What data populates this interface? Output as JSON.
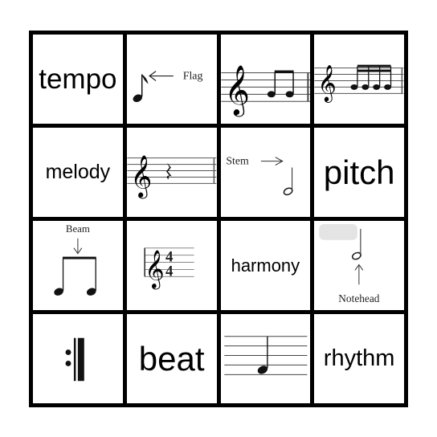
{
  "board": {
    "cells": [
      {
        "type": "text",
        "text": "tempo"
      },
      {
        "type": "image",
        "icon": "eighth-note-flag-icon",
        "label": "Flag"
      },
      {
        "type": "image",
        "icon": "treble-staff-two-eighth-notes-icon"
      },
      {
        "type": "image",
        "icon": "treble-staff-four-sixteenth-notes-icon"
      },
      {
        "type": "text",
        "text": "melody"
      },
      {
        "type": "image",
        "icon": "treble-staff-quarter-rest-icon"
      },
      {
        "type": "image",
        "icon": "half-note-stem-icon",
        "label": "Stem"
      },
      {
        "type": "text",
        "text": "pitch"
      },
      {
        "type": "image",
        "icon": "beamed-eighth-notes-icon",
        "label": "Beam"
      },
      {
        "type": "image",
        "icon": "treble-clef-time-signature-icon",
        "time_signature": "4/4"
      },
      {
        "type": "text",
        "text": "harmony"
      },
      {
        "type": "image",
        "icon": "half-note-notehead-icon",
        "label": "Notehead"
      },
      {
        "type": "image",
        "icon": "repeat-sign-icon"
      },
      {
        "type": "text",
        "text": "beat"
      },
      {
        "type": "image",
        "icon": "staff-quarter-note-icon"
      },
      {
        "type": "text",
        "text": "rhythm"
      }
    ]
  }
}
